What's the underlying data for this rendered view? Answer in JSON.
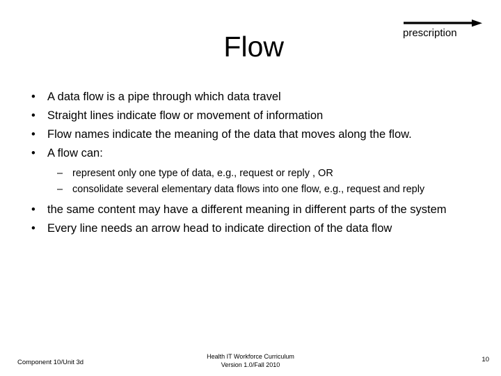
{
  "slide": {
    "title": "Flow",
    "background_color": "#ffffff",
    "text_color": "#000000"
  },
  "diagram": {
    "arrow_label": "prescription",
    "arrow_icon": "arrow-right-icon",
    "arrow_color": "#000000"
  },
  "body": {
    "bullets": [
      {
        "level": 1,
        "marker": "•",
        "text": "A data flow is a pipe through which data travel"
      },
      {
        "level": 1,
        "marker": "•",
        "text": "Straight lines indicate flow or movement of information"
      },
      {
        "level": 1,
        "marker": "•",
        "text": "Flow names indicate the meaning of the data that moves along the flow."
      },
      {
        "level": 1,
        "marker": "•",
        "text": "A flow can:"
      },
      {
        "level": 2,
        "marker": "–",
        "text": " represent only one type of data, e.g., request or reply , OR"
      },
      {
        "level": 2,
        "marker": "–",
        "text": "consolidate several elementary data flows into one flow, e.g., request and reply"
      },
      {
        "level": 1,
        "marker": "•",
        "text": "the same content may have a different meaning in different parts of the system"
      },
      {
        "level": 1,
        "marker": "•",
        "text": "Every line needs an arrow head to indicate direction of the data flow"
      }
    ]
  },
  "footer": {
    "left": "Component 10/Unit 3d",
    "center_line1": "Health IT Workforce Curriculum",
    "center_line2": "Version 1.0/Fall 2010",
    "page_number": "10"
  }
}
